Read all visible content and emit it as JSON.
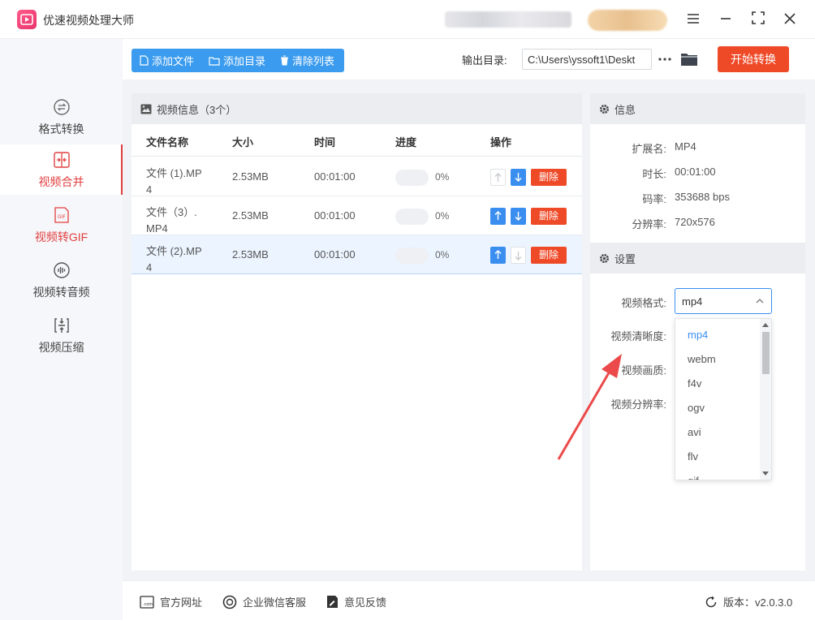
{
  "app": {
    "title": "优速视频处理大师"
  },
  "window": {
    "menu_icon": "menu-icon",
    "minimize_icon": "minimize-icon",
    "maximize_icon": "maximize-icon",
    "close_icon": "close-icon"
  },
  "sidebar": {
    "items": [
      {
        "label": "格式转换",
        "icon": "convert-icon",
        "active": false
      },
      {
        "label": "视频合并",
        "icon": "merge-icon",
        "active": true
      },
      {
        "label": "视频转GIF",
        "icon": "gif-icon",
        "active": false
      },
      {
        "label": "视频转音频",
        "icon": "audio-icon",
        "active": false
      },
      {
        "label": "视频压缩",
        "icon": "compress-icon",
        "active": false
      }
    ]
  },
  "toolbar": {
    "add_file": "添加文件",
    "add_dir": "添加目录",
    "clear_list": "清除列表",
    "output_label": "输出目录:",
    "output_path": "C:\\Users\\yssoft1\\Deskt",
    "start": "开始转换"
  },
  "file_list": {
    "title": "视频信息（3个）",
    "columns": [
      "文件名称",
      "大小",
      "时间",
      "进度",
      "操作"
    ],
    "rows": [
      {
        "name": "文件 (1).MP4",
        "size": "2.53MB",
        "time": "00:01:00",
        "progress": 0,
        "progress_text": "0%",
        "delete": "删除"
      },
      {
        "name": "文件（3）.MP4",
        "size": "2.53MB",
        "time": "00:01:00",
        "progress": 0,
        "progress_text": "0%",
        "delete": "删除"
      },
      {
        "name": "文件 (2).MP4",
        "size": "2.53MB",
        "time": "00:01:00",
        "progress": 0,
        "progress_text": "0%",
        "delete": "删除"
      }
    ]
  },
  "info": {
    "title": "信息",
    "ext_label": "扩展名:",
    "ext": "MP4",
    "duration_label": "时长:",
    "duration": "00:01:00",
    "bitrate_label": "码率:",
    "bitrate": "353688 bps",
    "resolution_label": "分辨率:",
    "resolution": "720x576"
  },
  "settings": {
    "title": "设置",
    "format_label": "视频格式:",
    "format_value": "mp4",
    "clarity_label": "视频清晰度:",
    "quality_label": "视频画质:",
    "resolution_label": "视频分辨率:",
    "format_options": [
      "mp4",
      "webm",
      "f4v",
      "ogv",
      "avi",
      "flv",
      "gif"
    ]
  },
  "footer": {
    "website": "官方网址",
    "wechat": "企业微信客服",
    "feedback": "意见反馈",
    "version": "版本：v2.0.3.0"
  },
  "colors": {
    "accent_blue": "#3a9bef",
    "accent_red": "#ef4a28",
    "active_nav": "#e23f3f",
    "annotation": "#ec4a4a"
  }
}
